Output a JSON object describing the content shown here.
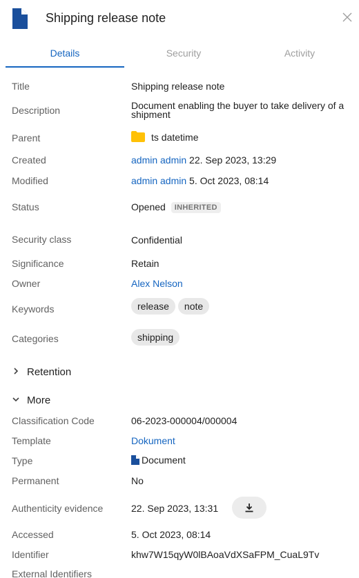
{
  "header": {
    "title": "Shipping release note",
    "close_icon": "close-icon",
    "doc_icon": "document-icon",
    "accent": "#1565c0"
  },
  "tabs": [
    {
      "label": "Details",
      "active": true
    },
    {
      "label": "Security",
      "active": false
    },
    {
      "label": "Activity",
      "active": false
    }
  ],
  "properties": {
    "title": {
      "label": "Title",
      "value": "Shipping release note"
    },
    "description": {
      "label": "Description",
      "value": "Document enabling the buyer to take delivery of a shipment"
    },
    "parent": {
      "label": "Parent",
      "value": "ts datetime",
      "icon": "folder-icon"
    },
    "created": {
      "label": "Created",
      "user": "admin admin",
      "date": "22. Sep 2023, 13:29"
    },
    "modified": {
      "label": "Modified",
      "user": "admin admin",
      "date": "5. Oct 2023, 08:14"
    },
    "status": {
      "label": "Status",
      "value": "Opened",
      "badge": "INHERITED"
    },
    "security_class": {
      "label": "Security class",
      "value": "Confidential"
    },
    "significance": {
      "label": "Significance",
      "value": "Retain"
    },
    "owner": {
      "label": "Owner",
      "value": "Alex Nelson"
    },
    "keywords": {
      "label": "Keywords",
      "chips": [
        "release",
        "note"
      ]
    },
    "categories": {
      "label": "Categories",
      "chips": [
        "shipping"
      ]
    }
  },
  "sections": {
    "retention": {
      "label": "Retention",
      "expanded": false
    },
    "more": {
      "label": "More",
      "expanded": true
    }
  },
  "more": {
    "classification_code": {
      "label": "Classification Code",
      "value": "06-2023-000004/000004"
    },
    "template": {
      "label": "Template",
      "value": "Dokument"
    },
    "type": {
      "label": "Type",
      "value": "Document"
    },
    "permanent": {
      "label": "Permanent",
      "value": "No"
    },
    "authenticity_evidence": {
      "label": "Authenticity evidence",
      "value": "22. Sep 2023, 13:31",
      "button_icon": "download-icon"
    },
    "accessed": {
      "label": "Accessed",
      "value": "5. Oct 2023, 08:14"
    },
    "identifier": {
      "label": "Identifier",
      "value": "khw7W15qyW0lBAoaVdXSaFPM_CuaL9Tv"
    },
    "external_identifiers": {
      "label": "External Identifiers"
    }
  }
}
